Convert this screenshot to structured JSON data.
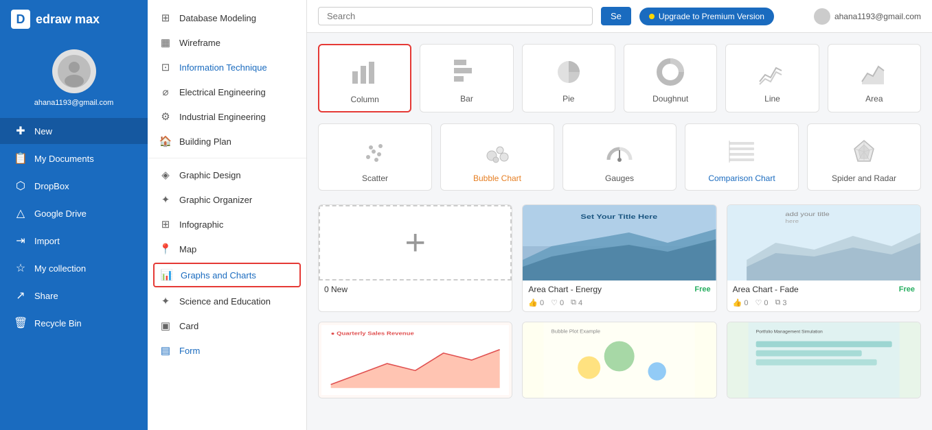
{
  "app": {
    "name": "edraw max",
    "logo_letter": "D"
  },
  "user": {
    "email": "ahana1193@gmail.com"
  },
  "topbar": {
    "search_placeholder": "Search",
    "search_button": "Se",
    "upgrade_label": "Upgrade to Premium Version"
  },
  "sidebar": {
    "items": [
      {
        "id": "new",
        "label": "New",
        "icon": "+"
      },
      {
        "id": "my-documents",
        "label": "My Documents",
        "icon": "📄"
      },
      {
        "id": "dropbox",
        "label": "DropBox",
        "icon": "🔷"
      },
      {
        "id": "google-drive",
        "label": "Google Drive",
        "icon": "△"
      },
      {
        "id": "import",
        "label": "Import",
        "icon": "→"
      },
      {
        "id": "my-collection",
        "label": "My collection",
        "icon": "☆"
      },
      {
        "id": "share",
        "label": "Share",
        "icon": "↗"
      },
      {
        "id": "recycle-bin",
        "label": "Recycle Bin",
        "icon": "🗑"
      }
    ]
  },
  "middle_panel": {
    "items": [
      {
        "id": "database-modeling",
        "label": "Database Modeling",
        "icon": "⊞"
      },
      {
        "id": "wireframe",
        "label": "Wireframe",
        "icon": "▦"
      },
      {
        "id": "information-technique",
        "label": "Information Technique",
        "icon": "⊡"
      },
      {
        "id": "electrical-engineering",
        "label": "Electrical Engineering",
        "icon": "⌀"
      },
      {
        "id": "industrial-engineering",
        "label": "Industrial Engineering",
        "icon": "⚙"
      },
      {
        "id": "building-plan",
        "label": "Building Plan",
        "icon": "🏠"
      },
      {
        "id": "graphic-design",
        "label": "Graphic Design",
        "icon": "◈"
      },
      {
        "id": "graphic-organizer",
        "label": "Graphic Organizer",
        "icon": "✦"
      },
      {
        "id": "infographic",
        "label": "Infographic",
        "icon": "⊞"
      },
      {
        "id": "map",
        "label": "Map",
        "icon": "📍"
      },
      {
        "id": "graphs-and-charts",
        "label": "Graphs and Charts",
        "icon": "📊",
        "selected": true
      },
      {
        "id": "science-and-education",
        "label": "Science and Education",
        "icon": "✦"
      },
      {
        "id": "card",
        "label": "Card",
        "icon": "▣"
      },
      {
        "id": "form",
        "label": "Form",
        "icon": "▤"
      }
    ]
  },
  "chart_types_row1": [
    {
      "id": "column",
      "label": "Column",
      "selected": true
    },
    {
      "id": "bar",
      "label": "Bar"
    },
    {
      "id": "pie",
      "label": "Pie"
    },
    {
      "id": "doughnut",
      "label": "Doughnut"
    },
    {
      "id": "line",
      "label": "Line"
    },
    {
      "id": "area",
      "label": "Area"
    }
  ],
  "chart_types_row2": [
    {
      "id": "scatter",
      "label": "Scatter"
    },
    {
      "id": "bubble",
      "label": "Bubble Chart",
      "color": "orange"
    },
    {
      "id": "gauges",
      "label": "Gauges"
    },
    {
      "id": "comparison",
      "label": "Comparison Chart",
      "color": "blue"
    },
    {
      "id": "spider",
      "label": "Spider and Radar"
    }
  ],
  "new_button": {
    "label": "0 New",
    "icon": "+"
  },
  "templates": [
    {
      "id": "new-blank",
      "type": "new"
    },
    {
      "id": "area-energy",
      "name": "Area Chart - Energy",
      "badge": "Free",
      "likes": "0",
      "hearts": "0",
      "copies": "4",
      "thumb_type": "energy"
    },
    {
      "id": "area-fade",
      "name": "Area Chart - Fade",
      "badge": "Free",
      "likes": "0",
      "hearts": "0",
      "copies": "3",
      "thumb_type": "fade"
    }
  ],
  "bottom_templates": [
    {
      "id": "quarterly-sales",
      "name": "Quarterly Sales Revenue",
      "thumb_type": "quarterly"
    },
    {
      "id": "bubble-plot",
      "name": "Bubble Plot Example",
      "thumb_type": "bubble"
    },
    {
      "id": "portfolio",
      "name": "Portfolio Management Simulation",
      "thumb_type": "portfolio"
    }
  ]
}
